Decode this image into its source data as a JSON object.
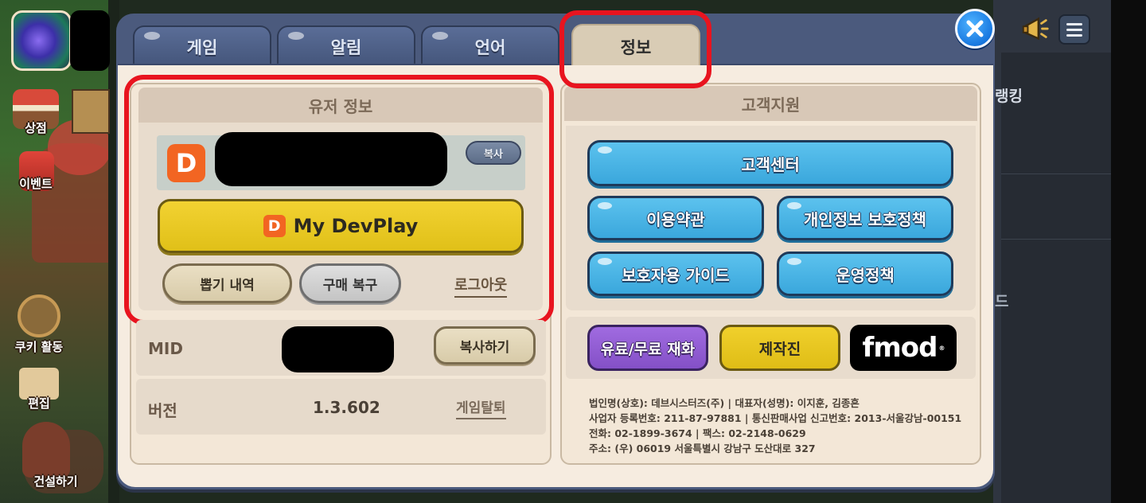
{
  "background": {
    "hud": {
      "shop_label": "상점",
      "event_label": "이벤트",
      "cookie_activity_label": "쿠키 활동",
      "edit_label": "편집",
      "build_label": "건설하기"
    },
    "right_panel": {
      "ranking_text": "랭킹",
      "partial_text": "드"
    },
    "icons": [
      "trophy-icon",
      "megaphone-icon",
      "menu-icon"
    ]
  },
  "dialog": {
    "tabs": [
      {
        "label": "게임",
        "active": false
      },
      {
        "label": "알림",
        "active": false
      },
      {
        "label": "언어",
        "active": false
      },
      {
        "label": "정보",
        "active": true
      }
    ],
    "user_info": {
      "title": "유저 정보",
      "account_logo": "D",
      "copy_small_label": "복사",
      "mydevplay_label": "My DevPlay",
      "gacha_history_label": "뽑기 내역",
      "restore_purchase_label": "구매 복구",
      "logout_label": "로그아웃"
    },
    "mid": {
      "label": "MID",
      "copy_label": "복사하기"
    },
    "version": {
      "label": "버전",
      "value": "1.3.602",
      "withdraw_label": "게임탈퇴"
    },
    "support": {
      "title": "고객지원",
      "customer_center_label": "고객센터",
      "terms_label": "이용약관",
      "privacy_label": "개인정보 보호정책",
      "guardian_guide_label": "보호자용 가이드",
      "operation_policy_label": "운영정책",
      "paid_free_label": "유료/무료 재화",
      "credits_label": "제작진",
      "fmod_label": "fmod"
    },
    "legal": {
      "line1": "법인명(상호): 데브시스터즈(주) | 대표자(성명): 이지훈, 김종흔",
      "line2": "사업자 등록번호: 211-87-97881 | 통신판매사업 신고번호: 2013-서울강남-00151",
      "line3": "전화: 02-1899-3674 | 팩스: 02-2148-0629",
      "line4": "주소: (우) 06019 서울특별시 강남구 도산대로 327"
    }
  },
  "colors": {
    "dialog_frame": "#4b5a7d",
    "highlight_red": "#e8141f",
    "devplay_orange": "#f26522",
    "button_yellow": "#f2d232",
    "button_blue": "#3aa7dc",
    "button_purple": "#8450c7"
  }
}
